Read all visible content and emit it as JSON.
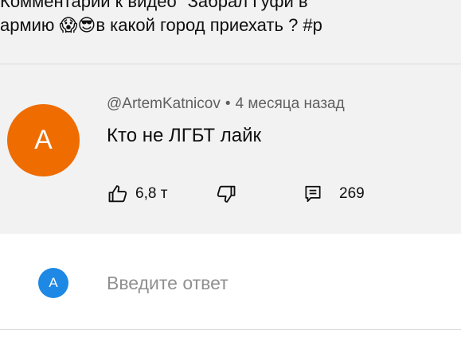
{
  "video": {
    "title_line1": "Комментарии к видео \"Забрал Гуфи в",
    "title_line2": "армию 😱😎в какой город приехать ? #р"
  },
  "comment": {
    "avatar_letter": "A",
    "avatar_color": "#ef6c00",
    "author": "@ArtemKatnicov",
    "separator": "•",
    "time": "4 месяца назад",
    "text": "Кто не ЛГБТ лайк",
    "likes": "6,8 т",
    "replies": "269"
  },
  "reply_box": {
    "avatar_letter": "A",
    "avatar_color": "#1e88e5",
    "placeholder": "Введите ответ"
  },
  "icons": {
    "like": "thumbs-up-icon",
    "dislike": "thumbs-down-icon",
    "replies": "comment-icon"
  }
}
